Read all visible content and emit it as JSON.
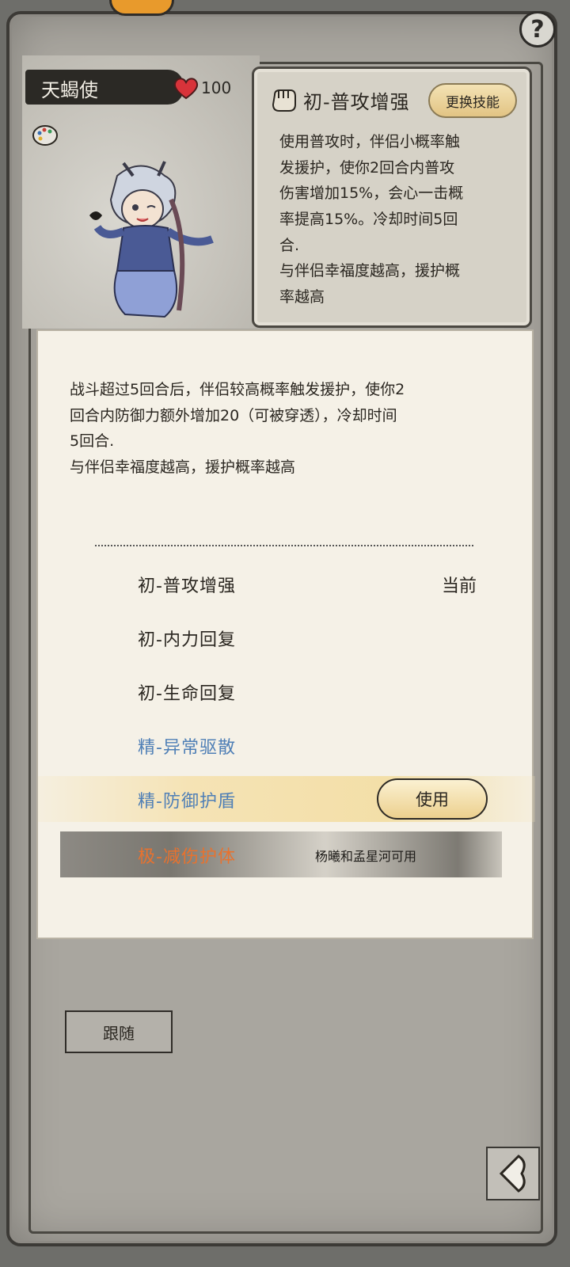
{
  "companion": {
    "name": "天蝎使",
    "affection": "100"
  },
  "skill_card": {
    "title": "初-普攻增强",
    "change_button": "更换技能",
    "description": "使用普攻时，伴侣小概率触\n发援护，使你2回合内普攻\n伤害增加15%，会心一击概\n率提高15%。冷却时间5回\n合.\n与伴侣幸福度越高，援护概\n率越高"
  },
  "popup": {
    "description": "战斗超过5回合后，伴侣较高概率触发援护，使你2\n回合内防御力额外增加20（可被穿透），冷却时间\n5回合.\n与伴侣幸福度越高，援护概率越高",
    "skills": [
      {
        "name": "初-普攻增强",
        "tier": "basic",
        "tag": "当前"
      },
      {
        "name": "初-内力回复",
        "tier": "basic"
      },
      {
        "name": "初-生命回复",
        "tier": "basic"
      },
      {
        "name": "精-异常驱散",
        "tier": "fine"
      },
      {
        "name": "精-防御护盾",
        "tier": "fine",
        "action": "使用"
      },
      {
        "name": "极-减伤护体",
        "tier": "max",
        "note": "杨曦和孟星河可用"
      }
    ]
  },
  "follow_button": "跟随",
  "colors": {
    "basic": "#2a2620",
    "fine": "#4f7fb6",
    "max": "#e8722e",
    "gold_button": "#ecd08e"
  },
  "icons": [
    "help-icon",
    "heart-icon",
    "palette-icon",
    "fist-icon",
    "back-arrow-icon"
  ]
}
